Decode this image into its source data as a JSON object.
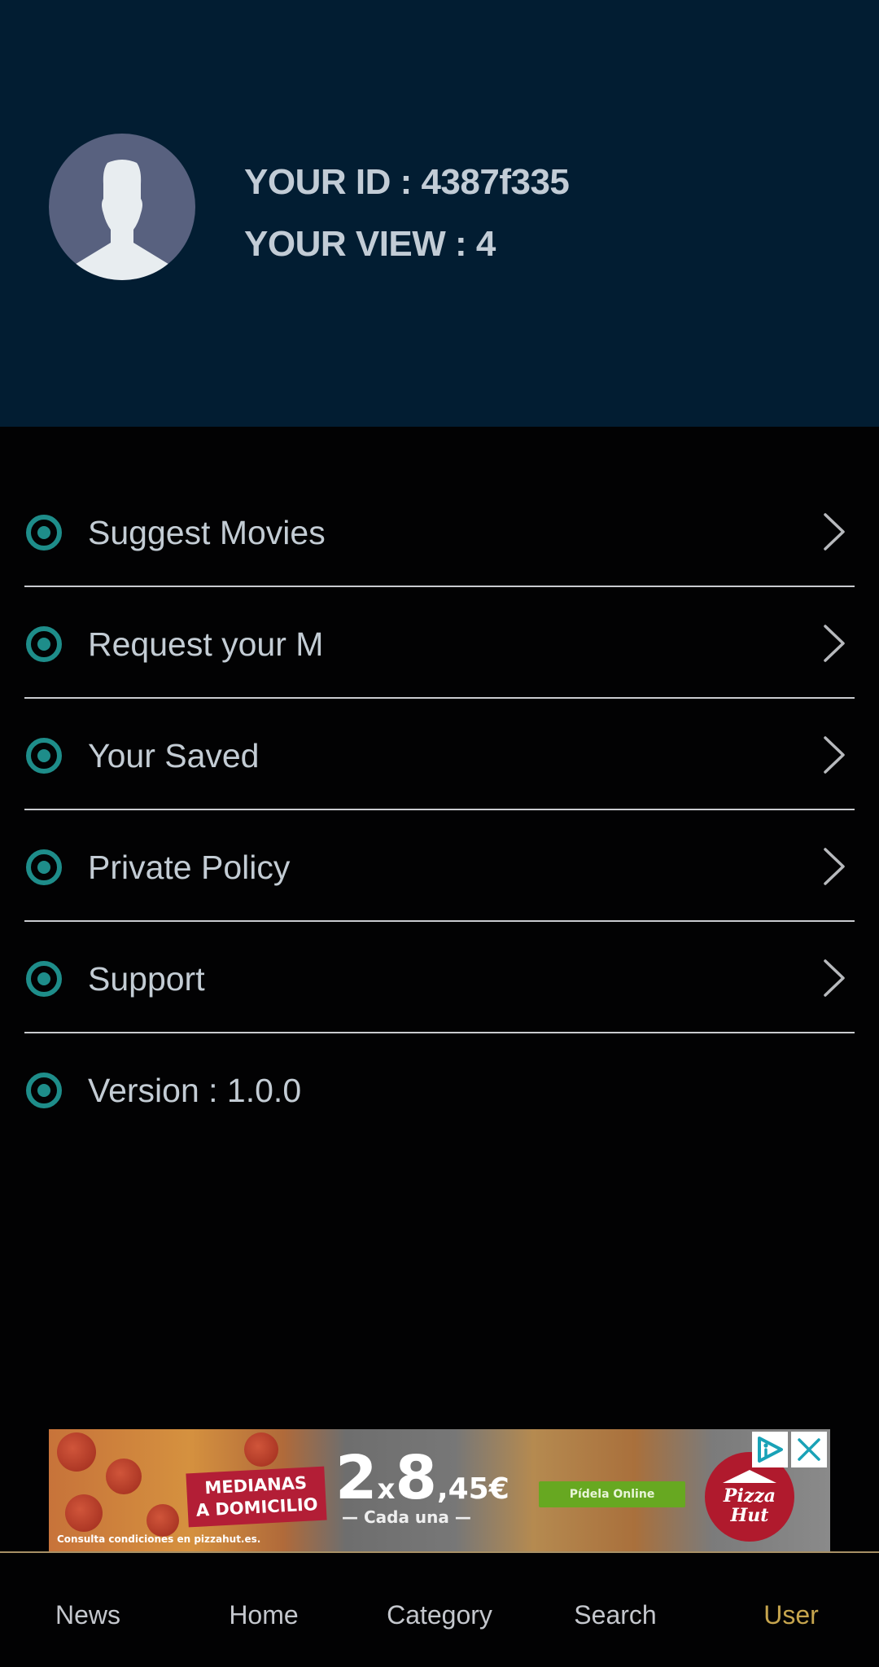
{
  "profile": {
    "id_label": "YOUR ID : 4387f335",
    "view_label": "YOUR VIEW : 4",
    "avatar_icon": "user-silhouette-icon"
  },
  "menu": {
    "items": [
      {
        "label": "Suggest Movies",
        "icon": "radio-dot-icon",
        "chevron": true
      },
      {
        "label": "Request your M",
        "icon": "radio-dot-icon",
        "chevron": true
      },
      {
        "label": "Your Saved",
        "icon": "radio-dot-icon",
        "chevron": true
      },
      {
        "label": "Private Policy",
        "icon": "radio-dot-icon",
        "chevron": true
      },
      {
        "label": "Support",
        "icon": "radio-dot-icon",
        "chevron": true
      },
      {
        "label": "Version : 1.0.0",
        "icon": "radio-dot-icon",
        "chevron": false
      }
    ]
  },
  "ad": {
    "tag_line1": "MEDIANAS",
    "tag_line2": "A DOMICILIO",
    "price_big": "2",
    "price_x": "x",
    "price_main": "8",
    "price_cents": ",45€",
    "price_sub": "— Cada una —",
    "cta": "Pídela Online",
    "brand_line1": "Pizza",
    "brand_line2": "Hut",
    "disclaimer": "Consulta condiciones en pizzahut.es.",
    "choices_icon": "ad-choices-icon",
    "close_icon": "close-icon"
  },
  "bottom_nav": {
    "items": [
      {
        "label": "News",
        "active": false
      },
      {
        "label": "Home",
        "active": false
      },
      {
        "label": "Category",
        "active": false
      },
      {
        "label": "Search",
        "active": false
      },
      {
        "label": "User",
        "active": true
      }
    ]
  },
  "colors": {
    "header_bg": "#021d32",
    "page_bg": "#020203",
    "accent_teal": "#1e8d8a",
    "active_nav": "#c6a54e",
    "avatar_bg": "#58617f"
  }
}
